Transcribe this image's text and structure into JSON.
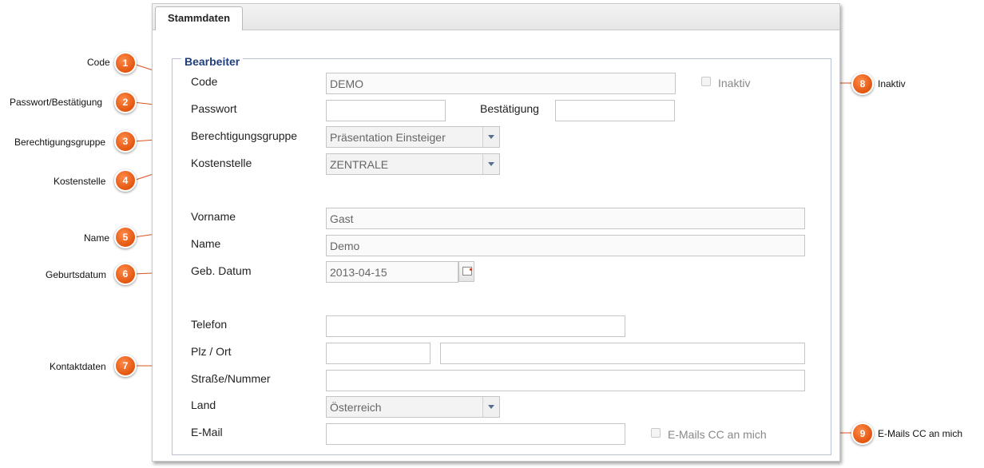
{
  "tab": {
    "label": "Stammdaten"
  },
  "fieldset": {
    "legend": "Bearbeiter"
  },
  "labels": {
    "code": "Code",
    "passwort": "Passwort",
    "bestaetigung": "Bestätigung",
    "berechtigungsgruppe": "Berechtigungsgruppe",
    "kostenstelle": "Kostenstelle",
    "vorname": "Vorname",
    "name": "Name",
    "geburtsdatum": "Geb. Datum",
    "telefon": "Telefon",
    "plz_ort": "Plz / Ort",
    "strasse": "Straße/Nummer",
    "land": "Land",
    "email": "E-Mail",
    "inaktiv": "Inaktiv",
    "emails_cc": "E-Mails CC an mich"
  },
  "values": {
    "code": "DEMO",
    "passwort": "",
    "bestaetigung": "",
    "berechtigungsgruppe": "Präsentation Einsteiger",
    "kostenstelle": "ZENTRALE",
    "vorname": "Gast",
    "name": "Demo",
    "geburtsdatum": "2013-04-15",
    "telefon": "",
    "plz": "",
    "ort": "",
    "strasse": "",
    "land": "Österreich",
    "email": "",
    "inaktiv": false,
    "emails_cc": false
  },
  "annotations": [
    {
      "number": "1",
      "label": "Code"
    },
    {
      "number": "2",
      "label": "Passwort/Bestätigung"
    },
    {
      "number": "3",
      "label": "Berechtigungsgruppe"
    },
    {
      "number": "4",
      "label": "Kostenstelle"
    },
    {
      "number": "5",
      "label": "Name"
    },
    {
      "number": "6",
      "label": "Geburtsdatum"
    },
    {
      "number": "7",
      "label": "Kontaktdaten"
    },
    {
      "number": "8",
      "label": "Inaktiv"
    },
    {
      "number": "9",
      "label": "E-Mails CC an mich"
    }
  ],
  "colors": {
    "badge": "#e2560f",
    "legend": "#1f3e7a",
    "leader_line": "#d9531e"
  }
}
